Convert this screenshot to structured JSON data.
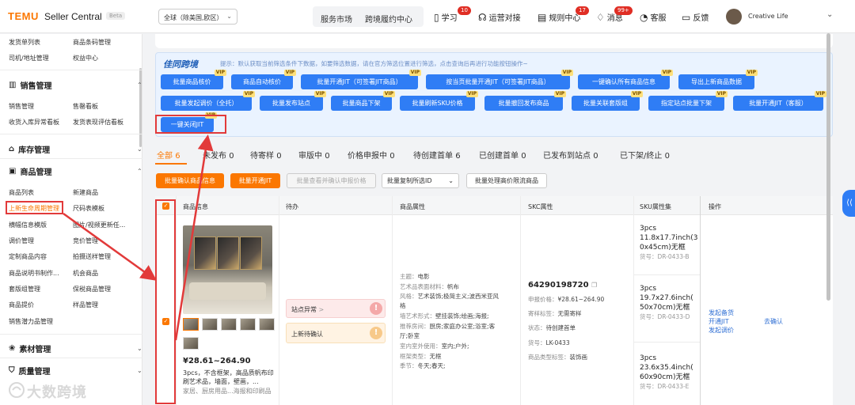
{
  "header": {
    "logo": "TEMU",
    "app_title": "Seller Central",
    "badge": "Beta",
    "region": "全球（除美国,欧区）",
    "service_market": "服务市场",
    "cross_border": "跨境履约中心",
    "nav": [
      {
        "label": "学习",
        "icon": "book-icon",
        "badge": "10"
      },
      {
        "label": "运营对接",
        "icon": "headset-icon",
        "badge": ""
      },
      {
        "label": "规则中心",
        "icon": "document-icon",
        "badge": "17"
      },
      {
        "label": "消息",
        "icon": "bell-icon",
        "badge": "99+"
      },
      {
        "label": "客服",
        "icon": "support-icon",
        "badge": ""
      },
      {
        "label": "反馈",
        "icon": "feedback-icon",
        "badge": ""
      }
    ],
    "user": "Creative Life"
  },
  "sidebar": {
    "rows": [
      [
        "发货单列表",
        "商品条码管理"
      ],
      [
        "司机/地址管理",
        "权益中心"
      ]
    ],
    "sections": [
      {
        "title": "销售管理",
        "icon": "chart-icon",
        "rows": [
          [
            "销售管理",
            "售罄看板"
          ],
          [
            "收货入库异常看板",
            "发货表现评估看板"
          ]
        ]
      },
      {
        "title": "库存管理",
        "icon": "warehouse-icon",
        "rows": []
      },
      {
        "title": "商品管理",
        "icon": "box-icon",
        "rows": [
          [
            "商品列表",
            "新建商品"
          ],
          [
            "上新生命周期管理",
            "尺码表模板"
          ],
          [
            "横幅信息模版",
            "图片/视频更新任..."
          ],
          [
            "调价管理",
            "竞价管理"
          ],
          [
            "定制商品内容",
            "拍摄送样管理"
          ],
          [
            "商品说明书制作...",
            "机会商品"
          ],
          [
            "套版组管理",
            "保税商品管理"
          ],
          [
            "商品提价",
            "样品管理"
          ],
          [
            "销售潜力品管理",
            ""
          ]
        ]
      },
      {
        "title": "素材管理",
        "icon": "material-icon",
        "rows": []
      },
      {
        "title": "质量管理",
        "icon": "shield-icon",
        "rows": []
      }
    ]
  },
  "toolbox": {
    "brand": "佳同跨境",
    "hint": "提示：默认获取当前筛选条件下数据，如要筛选数据，请在官方筛选位置进行筛选，点击查询后再进行功能按钮操作~",
    "vip_label": "VIP",
    "row1": [
      "批量商品核价",
      "商品自动核价",
      "批量开通JIT（可签署JIT商品）",
      "按当页批量开通JIT（可签署JIT商品）",
      "一键确认所有商品信息",
      "导出上新商品数据"
    ],
    "row2": [
      "批量发起调价（全托）",
      "批量发布站点",
      "批量商品下架",
      "批量刷新SKU价格",
      "批量撤回发布商品",
      "批量关联套版组",
      "指定站点批量下架",
      "批量开通JIT（客服）"
    ],
    "row3": [
      "一键关闭JIT"
    ]
  },
  "tabs": [
    {
      "label": "全部",
      "count": "6"
    },
    {
      "label": "未发布",
      "count": "0"
    },
    {
      "label": "待寄样",
      "count": "0"
    },
    {
      "label": "审版中",
      "count": "0"
    },
    {
      "label": "价格申报中",
      "count": "0"
    },
    {
      "label": "待创建首单",
      "count": "6"
    },
    {
      "label": "已创建首单",
      "count": "0"
    },
    {
      "label": "已发布到站点",
      "count": "0"
    },
    {
      "label": "已下架/终止",
      "count": "0"
    }
  ],
  "actions": {
    "confirm": "批量确认商品信息",
    "open_jit": "批量开通JIT",
    "view_confirm": "批量查看并确认申报价格",
    "copy_select": "批量复制所选ID",
    "handle_high": "批量处理高价限流商品"
  },
  "table": {
    "headers": [
      "商品信息",
      "待办",
      "商品属性",
      "SKC属性",
      "SKU属性集",
      "操作"
    ],
    "product": {
      "price": "¥28.61~264.90",
      "desc": "3pcs，不含框架，高品质帆布印刷艺术品，墙面，壁画，...",
      "desc2": "家居、厨房用品...海报和印刷品"
    },
    "todo": [
      {
        "label": "站点异常",
        "chevron": ">"
      },
      {
        "label": "上新待确认"
      }
    ],
    "attributes": [
      {
        "k": "主题：",
        "v": "电影"
      },
      {
        "k": "艺术品表面材料：",
        "v": "帆布"
      },
      {
        "k": "风格：",
        "v": "艺术装饰;极简主义;波西米亚风"
      },
      {
        "k": "",
        "v": "格"
      },
      {
        "k": "墙艺术形式：",
        "v": "壁挂装饰;绘画;海报;"
      },
      {
        "k": "推荐房间：",
        "v": "厨房;家庭办公室;浴室;客"
      },
      {
        "k": "",
        "v": "厅;卧室"
      },
      {
        "k": "室内室外使用：",
        "v": "室内;户外;"
      },
      {
        "k": "框架类型：",
        "v": "无框"
      },
      {
        "k": "季节：",
        "v": "冬天;春天;"
      }
    ],
    "skc": {
      "id": "64290198720",
      "rows": [
        {
          "k": "申报价格：",
          "v": "¥28.61~264.90"
        },
        {
          "k": "寄样标签：",
          "v": "无需寄样"
        },
        {
          "k": "状态：",
          "v": "待创建首单"
        },
        {
          "k": "货号：",
          "v": "LK-0433"
        },
        {
          "k": "商品类型标签：",
          "v": "装饰画"
        }
      ]
    },
    "skus": [
      {
        "l1": "3pcs",
        "l2": "11.8x17.7inch(3",
        "l3": "0x45cm)无框",
        "code": "货号：DR-0433-B"
      },
      {
        "l1": "3pcs",
        "l2": "19.7x27.6inch(",
        "l3": "50x70cm)无框",
        "code": "货号：DR-0433-D"
      },
      {
        "l1": "3pcs",
        "l2": "23.6x35.4inch(",
        "l3": "60x90cm)无框",
        "code": "货号：DR-0433-E"
      }
    ],
    "ops": [
      "发起备货",
      "开通JIT",
      "发起调价"
    ],
    "confirm_link": "去确认"
  },
  "watermark": "大数跨境"
}
